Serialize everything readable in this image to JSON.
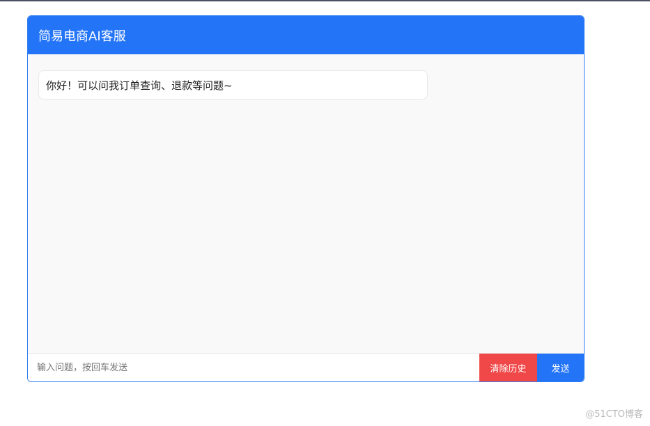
{
  "header": {
    "title": "简易电商AI客服"
  },
  "messages": [
    {
      "role": "bot",
      "text": "你好！可以问我订单查询、退款等问题~"
    }
  ],
  "input": {
    "value": "",
    "placeholder": "输入问题，按回车发送"
  },
  "buttons": {
    "clear_label": "清除历史",
    "send_label": "发送"
  },
  "watermark": "@51CTO博客",
  "colors": {
    "primary": "#2374f7",
    "danger": "#f04848",
    "chat_bg": "#f9f9f9"
  }
}
